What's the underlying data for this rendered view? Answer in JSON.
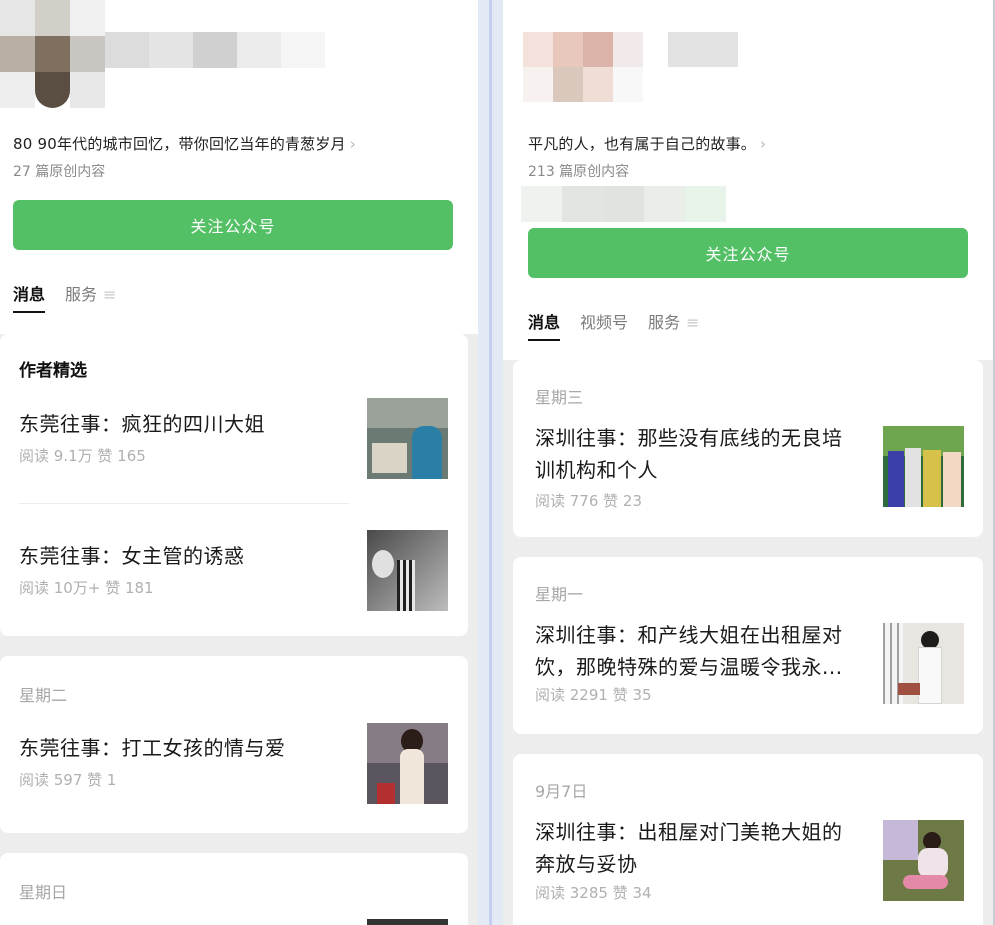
{
  "left": {
    "description": "80 90年代的城市回忆，带你回忆当年的青葱岁月",
    "chevron": "›",
    "count": "27 篇原创内容",
    "follow_button": "关注公众号",
    "tabs": [
      "消息",
      "服务"
    ],
    "menu_glyph": "≡",
    "section_title": "作者精选",
    "articles": [
      {
        "title": "东莞往事：疯狂的四川大姐",
        "meta": "阅读 9.1万  赞 165"
      },
      {
        "title": "东莞往事：女主管的诱惑",
        "meta": "阅读 10万+  赞 181"
      },
      {
        "day": "星期二",
        "title": "东莞往事：打工女孩的情与爱",
        "meta": "阅读 597  赞 1"
      },
      {
        "day": "星期日"
      }
    ]
  },
  "right": {
    "description": "平凡的人，也有属于自己的故事。",
    "chevron": "›",
    "count": "213 篇原创内容",
    "follow_button": "关注公众号",
    "tabs": [
      "消息",
      "视频号",
      "服务"
    ],
    "menu_glyph": "≡",
    "articles": [
      {
        "day": "星期三",
        "title_line1": "深圳往事：那些没有底线的无良培",
        "title_line2": "训机构和个人",
        "meta": "阅读 776  赞 23"
      },
      {
        "day": "星期一",
        "title_line1": "深圳往事：和产线大姐在出租屋对",
        "title_line2": "饮，那晚特殊的爱与温暖令我永...",
        "meta": "阅读 2291  赞 35"
      },
      {
        "day": "9月7日",
        "title_line1": "深圳往事：出租屋对门美艳大姐的",
        "title_line2": "奔放与妥协",
        "meta": "阅读 3285  赞 34"
      }
    ]
  },
  "colors": {
    "accent": "#53c066",
    "panel_bg": "#ededed",
    "divider": "#c3cfee"
  }
}
